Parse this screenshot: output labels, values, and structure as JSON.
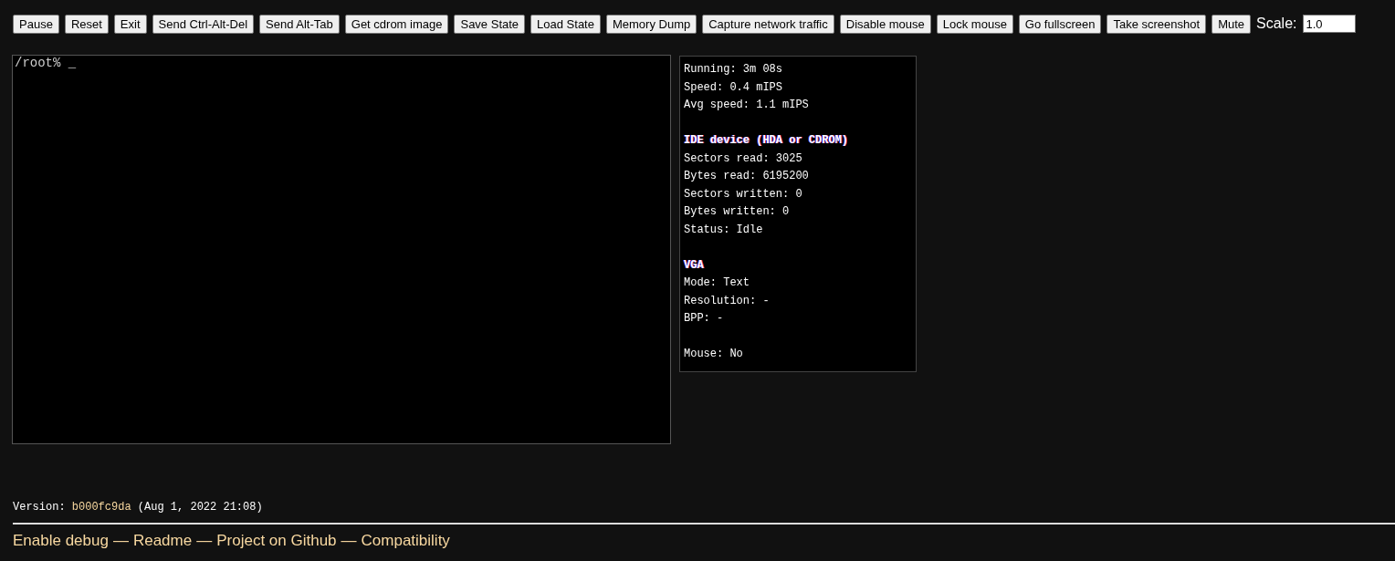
{
  "toolbar": {
    "buttons": [
      "Pause",
      "Reset",
      "Exit",
      "Send Ctrl-Alt-Del",
      "Send Alt-Tab",
      "Get cdrom image",
      "Save State",
      "Load State",
      "Memory Dump",
      "Capture network traffic",
      "Disable mouse",
      "Lock mouse",
      "Go fullscreen",
      "Take screenshot",
      "Mute"
    ],
    "scale": {
      "label": "Scale:",
      "value": "1.0"
    }
  },
  "terminal": {
    "lines": [
      "/root% _"
    ]
  },
  "stats": [
    {
      "lines": [
        "Running: 3m 08s",
        "Speed: 0.4 mIPS",
        "Avg speed: 1.1 mIPS"
      ]
    },
    {
      "heading": "IDE device (HDA or CDROM)",
      "lines": [
        "Sectors read: 3025",
        "Bytes read: 6195200",
        "Sectors written: 0",
        "Bytes written: 0",
        "Status: Idle"
      ]
    },
    {
      "heading": "VGA",
      "lines": [
        "Mode: Text",
        "Resolution: -",
        "BPP: -"
      ]
    },
    {
      "lines": [
        "Mouse: No"
      ]
    }
  ],
  "version": {
    "label": "Version: ",
    "link": "b000fc9da",
    "date": " (Aug 1, 2022 21:08)"
  },
  "footer": {
    "links": [
      "Enable debug",
      "Readme",
      "Project on Github",
      "Compatibility"
    ],
    "separators": [
      "—",
      "—",
      "—"
    ]
  }
}
